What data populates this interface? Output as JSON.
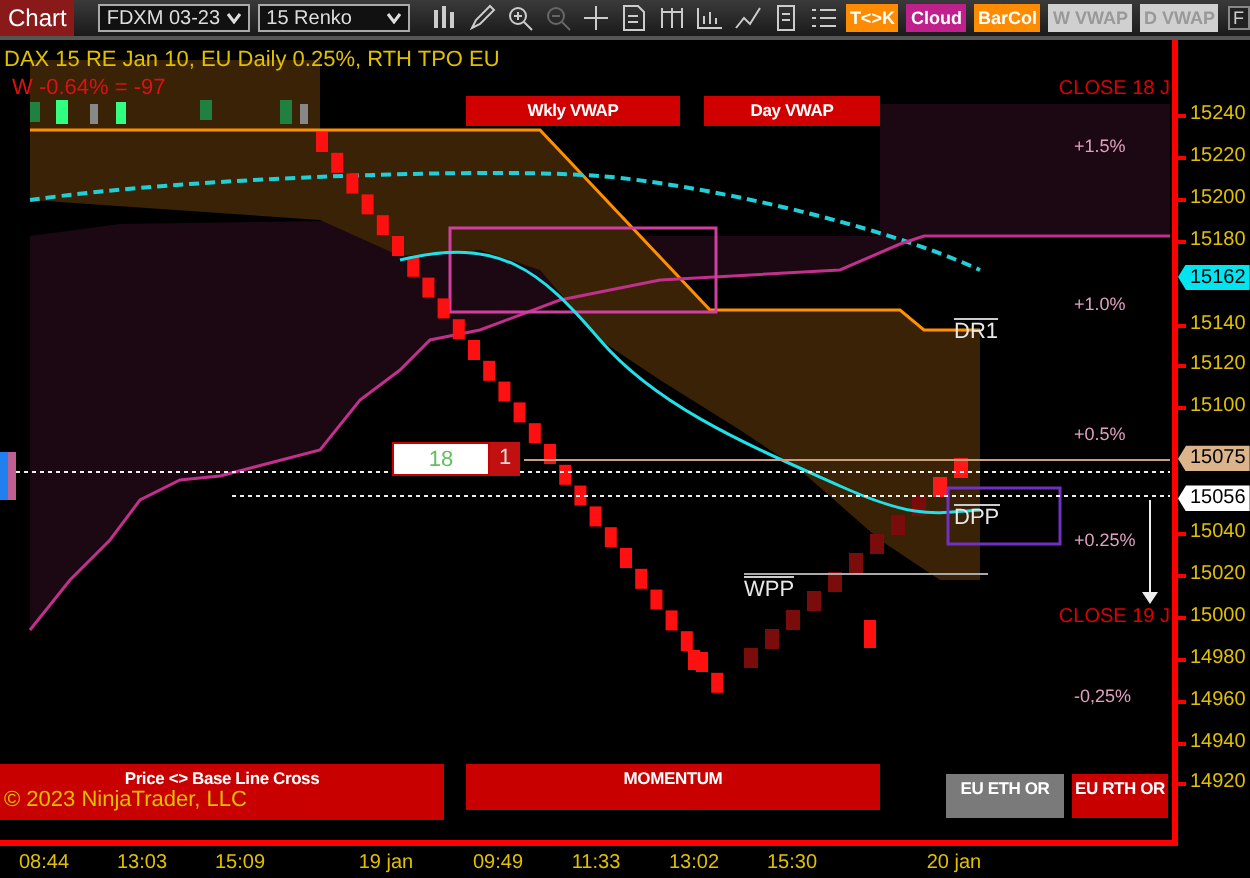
{
  "toolbar": {
    "tab": "Chart",
    "instrument": "FDXM 03-23",
    "period": "15 Renko",
    "toggles": [
      {
        "label": "T<>K",
        "on": true,
        "color": "#ff8c00"
      },
      {
        "label": "Cloud",
        "on": true,
        "color": "#c0208c"
      },
      {
        "label": "BarCol",
        "on": true,
        "color": "#ff8c00"
      },
      {
        "label": "W VWAP",
        "on": false,
        "color": "#d0d0d0"
      },
      {
        "label": "D VWAP",
        "on": false,
        "color": "#d0d0d0"
      }
    ],
    "corner_button": "F"
  },
  "chart": {
    "header": "DAX 15  RE  Jan 10, EU Daily 0.25%, RTH TPO EU",
    "week_change": "W -0.64% = -97",
    "banners": [
      {
        "label": "Wkly VWAP",
        "color": "#d00000"
      },
      {
        "label": "Day VWAP",
        "color": "#d00000"
      },
      {
        "label": "Price <> Base Line Cross",
        "color": "#c80000"
      },
      {
        "label": "MOMENTUM",
        "color": "#c80000"
      },
      {
        "label": "EU ETH OR",
        "color": "#7a7a7a"
      },
      {
        "label": "EU RTH OR",
        "color": "#c80000"
      }
    ],
    "levels": [
      {
        "label": "CLOSE 18 J",
        "kind": "close"
      },
      {
        "label": "+1.5%",
        "kind": "percent"
      },
      {
        "label": "+1.0%",
        "kind": "percent"
      },
      {
        "label": "DR1",
        "kind": "pivot"
      },
      {
        "label": "+0.5%",
        "kind": "percent"
      },
      {
        "label": "DPP",
        "kind": "pivot"
      },
      {
        "label": "+0.25%",
        "kind": "percent"
      },
      {
        "label": "WPP",
        "kind": "pivot"
      },
      {
        "label": "CLOSE 19 J",
        "kind": "close"
      },
      {
        "label": "-0,25%",
        "kind": "percent"
      }
    ],
    "counter": {
      "count": "18",
      "bricks": "1"
    },
    "copyright": "© 2023 NinjaTrader, LLC",
    "price_labels": [
      "15240",
      "15220",
      "15200",
      "15180",
      "15140",
      "15120",
      "15100",
      "15040",
      "15020",
      "15000",
      "14980",
      "14960",
      "14940",
      "14920"
    ],
    "price_markers": [
      {
        "value": "15162",
        "color": "#00e5f0"
      },
      {
        "value": "15075",
        "color": "#dcb48c"
      },
      {
        "value": "15056",
        "color": "#ffffff"
      }
    ],
    "time_labels": [
      "08:44",
      "13:03",
      "15:09",
      "19 jan",
      "09:49",
      "11:33",
      "13:02",
      "15:30",
      "20 jan"
    ]
  }
}
